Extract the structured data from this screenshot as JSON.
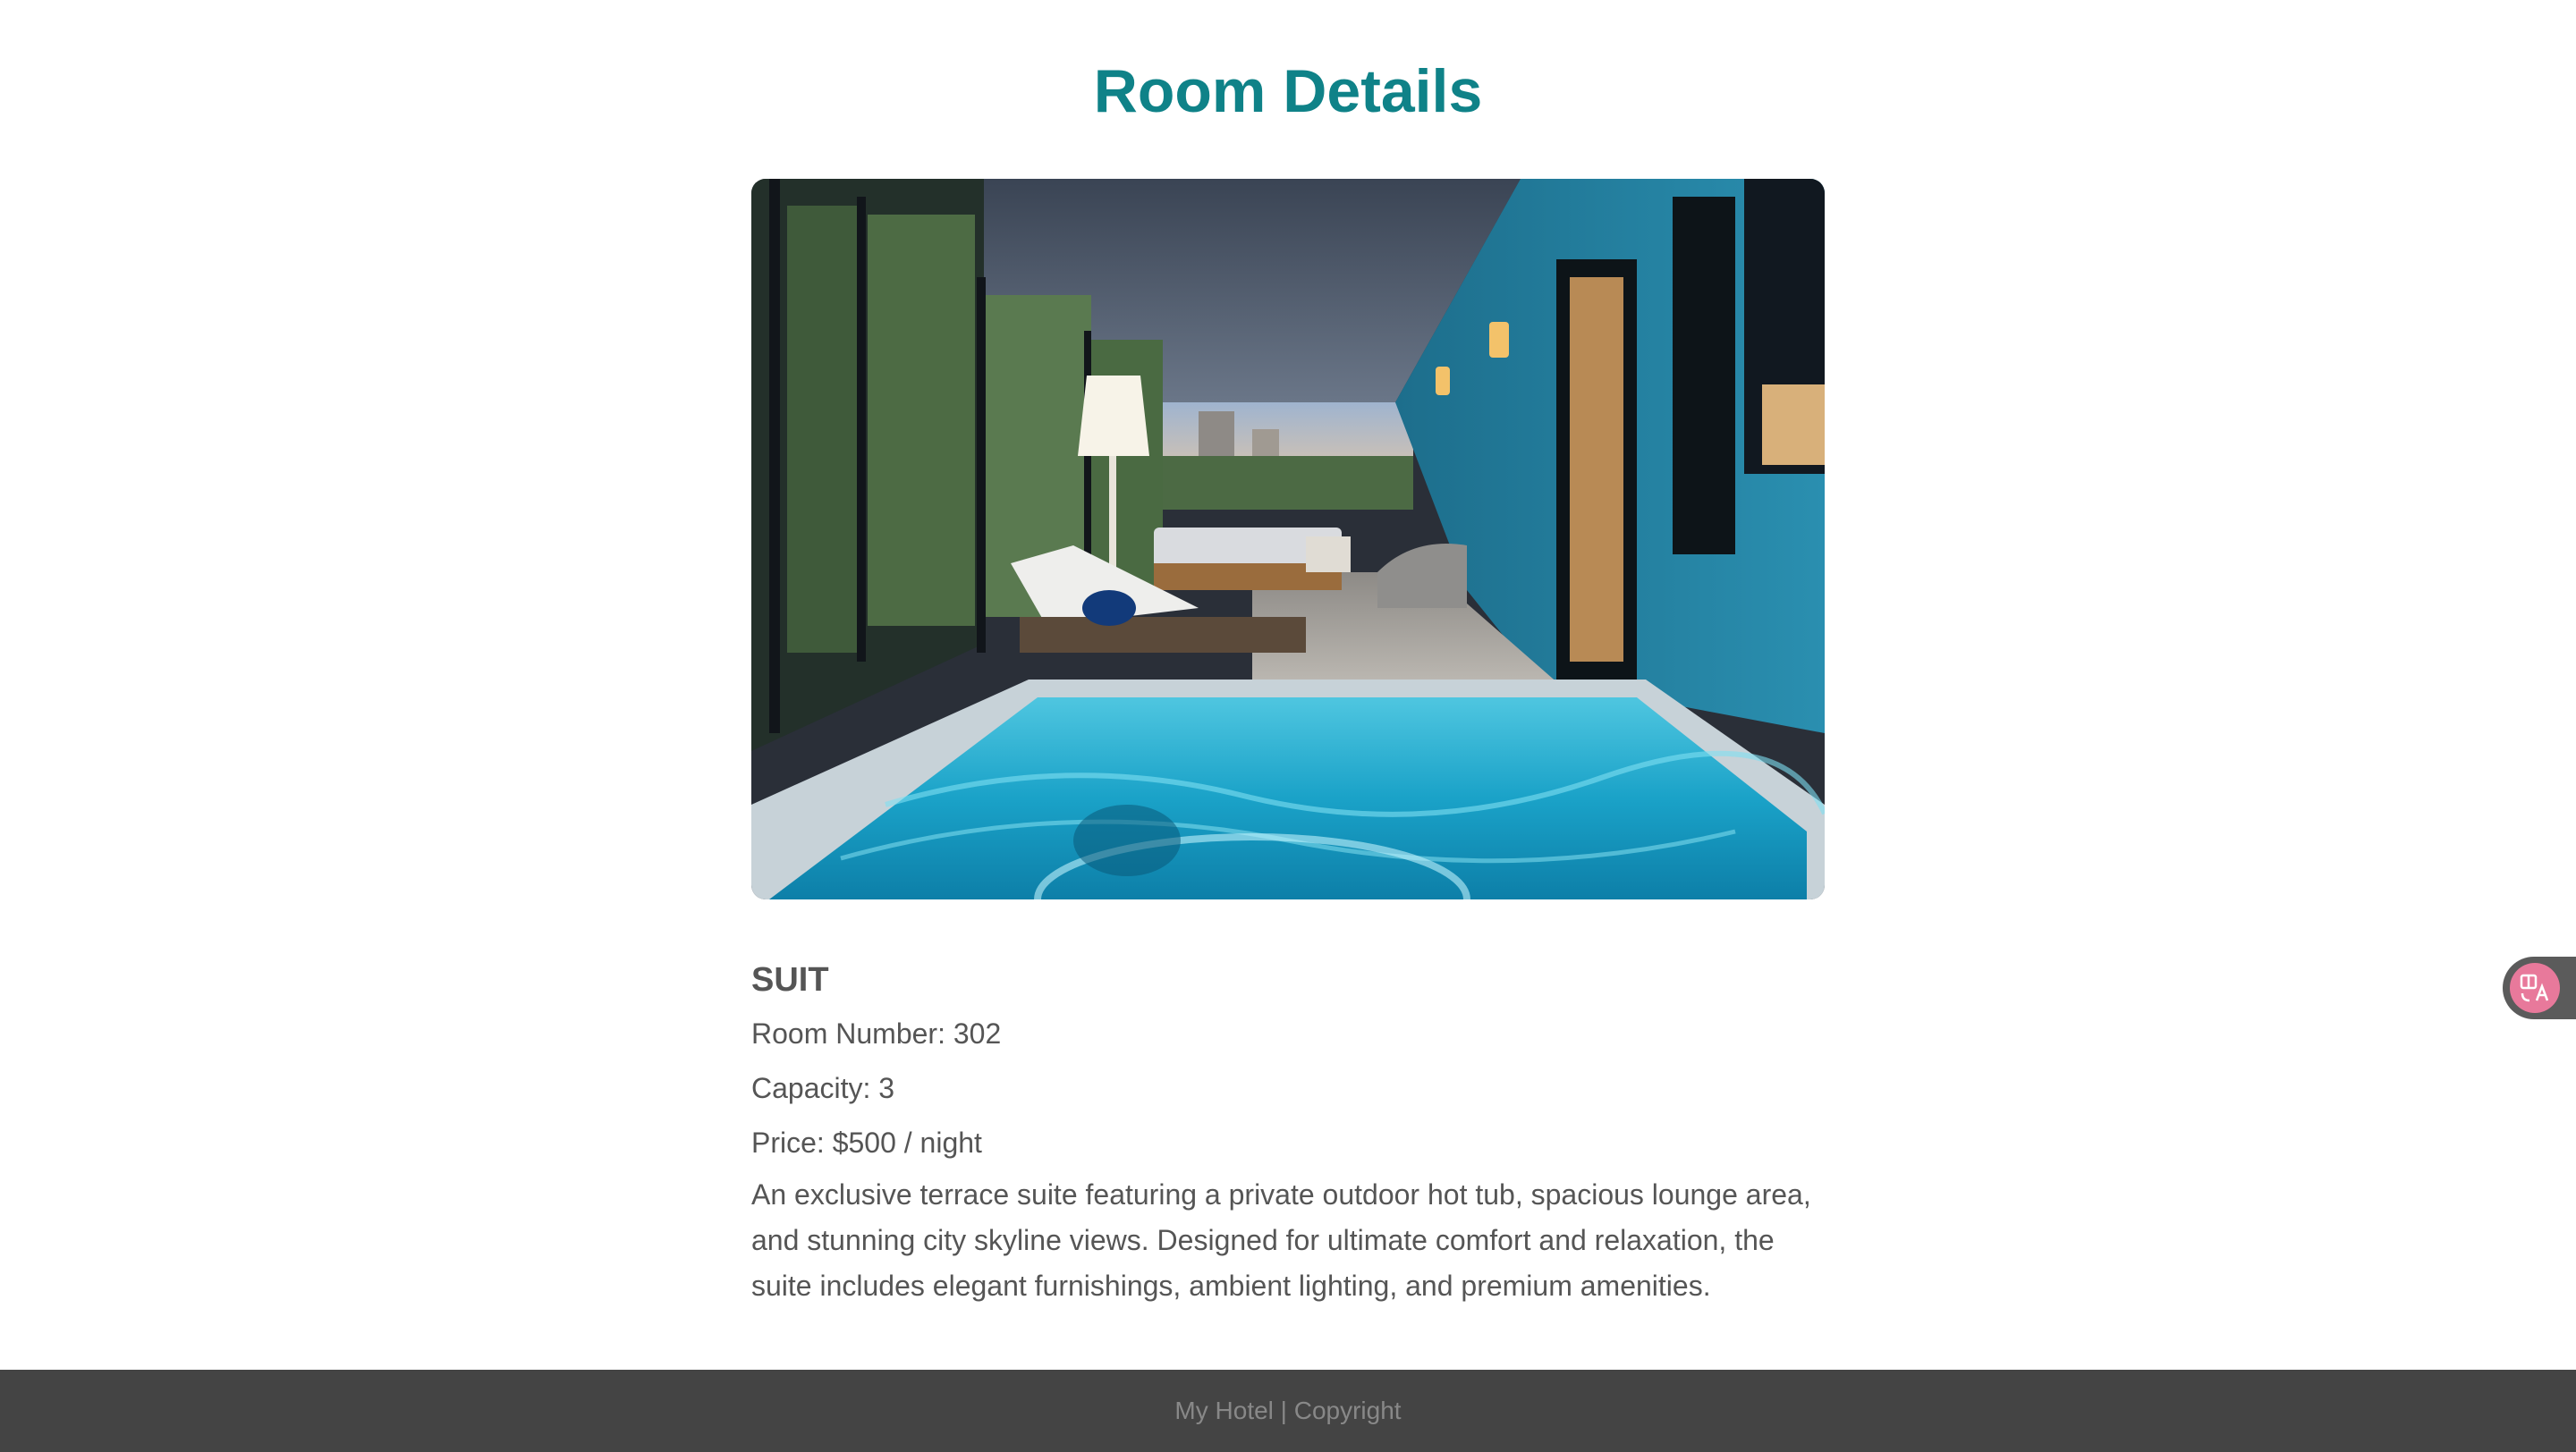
{
  "page": {
    "title": "Room Details"
  },
  "room": {
    "image_icon": "room-photo",
    "type": "SUIT",
    "room_number": "Room Number: 302",
    "capacity": "Capacity: 3",
    "price": "Price: $500 / night",
    "description": "An exclusive terrace suite featuring a private outdoor hot tub, spacious lounge area, and stunning city skyline views. Designed for ultimate comfort and relaxation, the suite includes elegant furnishings, ambient lighting, and premium amenities."
  },
  "footer": {
    "text": "My Hotel | Copyright"
  },
  "translate_widget": {
    "icon": "translate-icon"
  },
  "colors": {
    "title": "#0f8288",
    "text": "#555555",
    "footer_bg": "#444444",
    "footer_text": "#888888",
    "translate_badge": "#e8799b"
  }
}
